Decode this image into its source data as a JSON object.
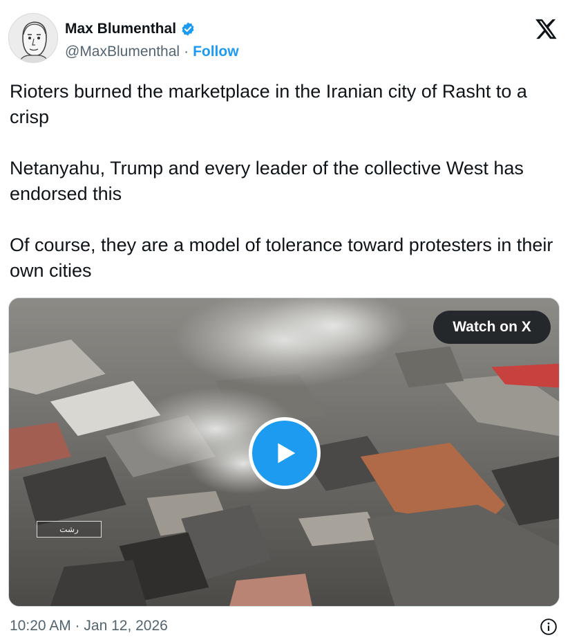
{
  "author": {
    "name": "Max Blumenthal",
    "handle": "@MaxBlumenthal",
    "separator": "·",
    "follow_label": "Follow"
  },
  "icons": {
    "verified": "verified-badge-icon",
    "x_logo": "x-logo-icon",
    "play": "play-icon",
    "info": "info-icon"
  },
  "post": {
    "paragraph_1": "Rioters burned the marketplace in the Iranian city of Rasht to a crisp",
    "paragraph_2": "Netanyahu, Trump and every leader of the collective West has endorsed this",
    "paragraph_3": "Of course, they are a model of tolerance toward protesters in their own cities"
  },
  "media": {
    "watch_label": "Watch on X",
    "overlay_caption": "رشت"
  },
  "footer": {
    "timestamp": "10:20 AM · Jan 12, 2026"
  },
  "colors": {
    "accent": "#1d9bf0",
    "text": "#0f1419",
    "muted": "#536471"
  }
}
